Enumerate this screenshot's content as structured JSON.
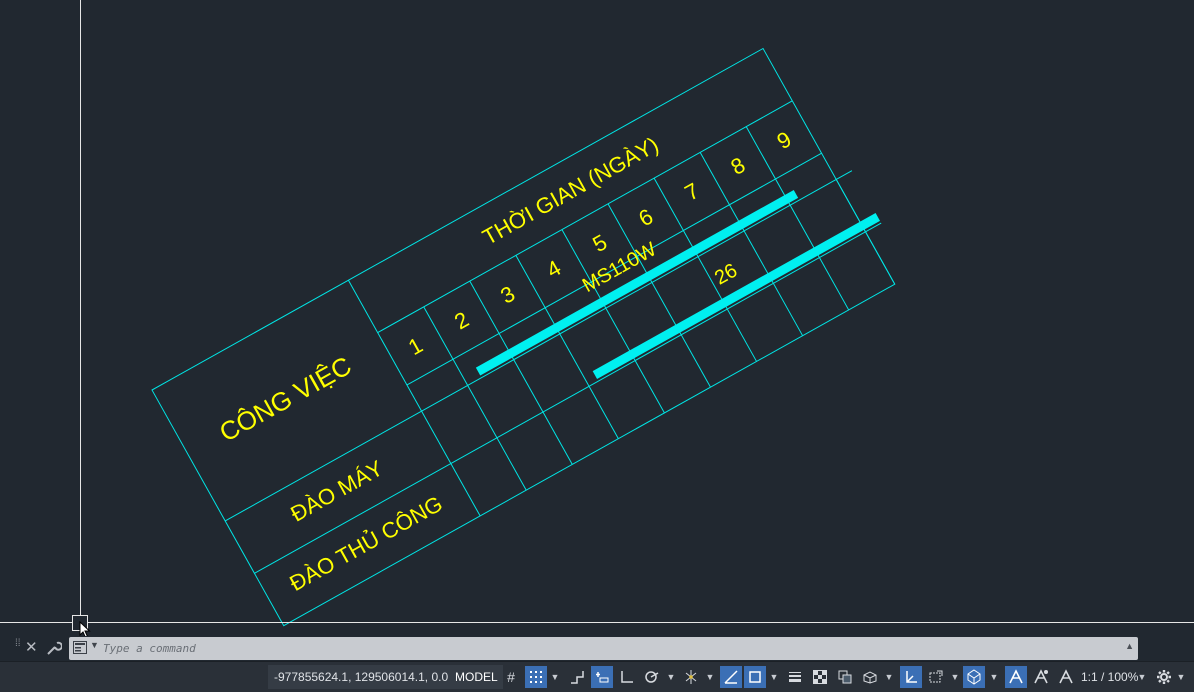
{
  "drawing": {
    "header_title": "THỜI GIAN (NGÀY)",
    "task_header": "CÔNG VIỆC",
    "days": [
      "1",
      "2",
      "3",
      "4",
      "5",
      "6",
      "7",
      "8",
      "9"
    ],
    "tasks": [
      "ĐÀO MÁY",
      "ĐÀO THỦ CÔNG"
    ],
    "bar_label_machine": "MS110W",
    "bar_label_manual": "26",
    "colors": {
      "lines": "#00e5e5",
      "text": "#ffff00",
      "bars": "#00f0f0",
      "background": "#212830"
    }
  },
  "command_line": {
    "placeholder": "Type a command"
  },
  "status_bar": {
    "coordinates": "-977855624.1, 129506014.1, 0.0",
    "model_tab": "MODEL",
    "annotation_scale": "1:1 / 100%"
  },
  "icons": [
    "grid-icon",
    "snap-icon",
    "ortho-icon",
    "polar-icon",
    "isodraft-icon",
    "object-snap-tracking-icon",
    "object-snap-icon",
    "lineweight-icon",
    "transparency-icon",
    "selection-cycling-icon",
    "3d-object-snap-icon",
    "dynamic-ucs-icon",
    "selection-filter-icon",
    "gizmo-icon",
    "annotation-visibility-icon",
    "auto-scale-icon",
    "annotation-scale-icon",
    "workspace-gear-icon"
  ]
}
